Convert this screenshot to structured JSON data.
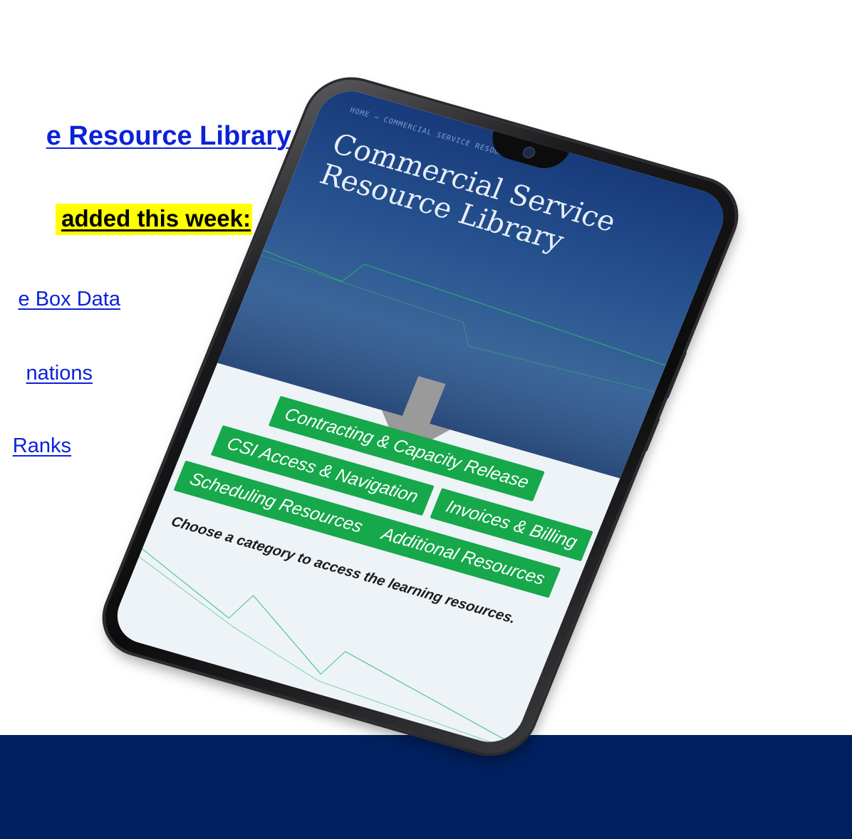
{
  "slide": {
    "title_link": "e Resource Library",
    "added_heading": " added this week:",
    "items": [
      "e Box Data",
      "nations",
      "Ranks"
    ]
  },
  "phone": {
    "breadcrumb": "HOME → COMMERCIAL SERVICE RESOURCE",
    "hero_title": "Commercial Service Resource Library",
    "categories": [
      "Contracting & Capacity Release",
      "CSI Access & Navigation",
      "Invoices & Billing",
      "Scheduling Resources",
      "Additional Resources"
    ],
    "instruction": "Choose a category to access the learning resources."
  },
  "colors": {
    "accent_green": "#16a84a",
    "link_blue": "#0b22d8",
    "band_navy": "#00205f",
    "highlight_yellow": "#ffff00"
  }
}
